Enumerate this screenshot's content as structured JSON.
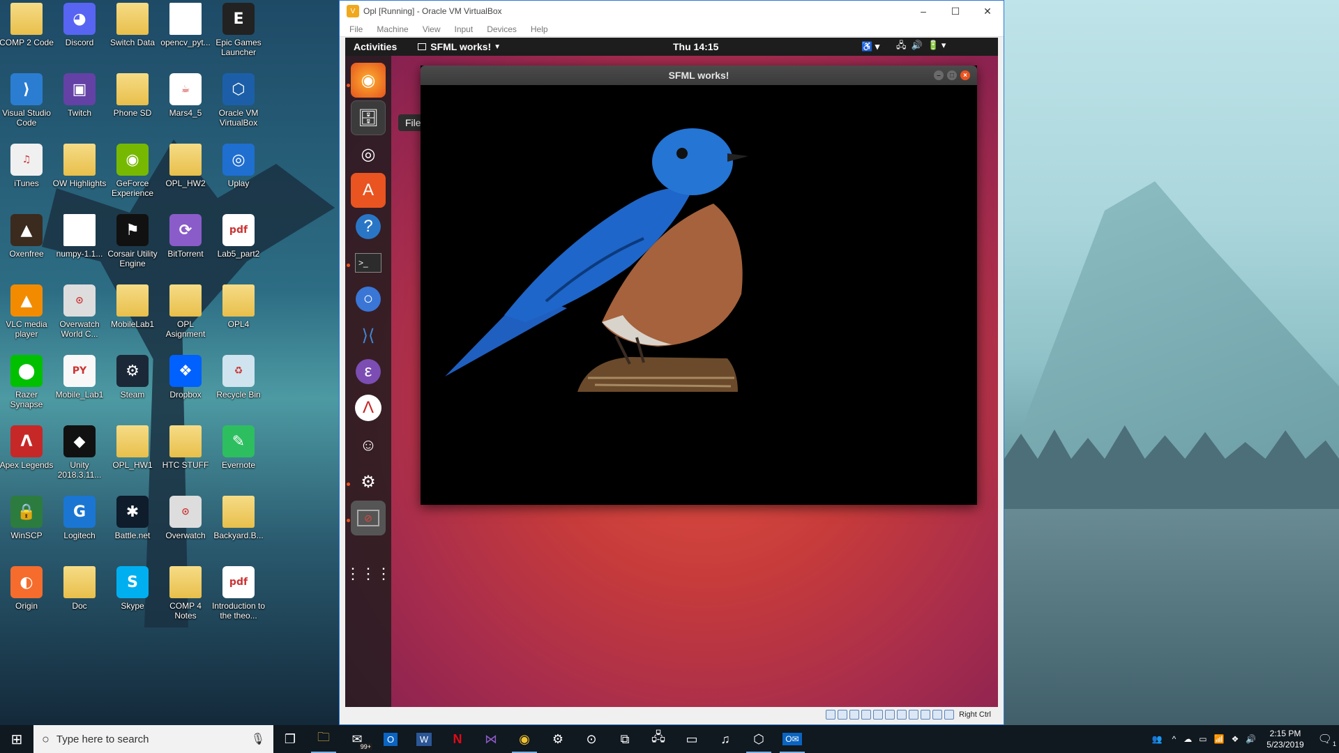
{
  "desktop": {
    "icons": [
      {
        "label": "COMP 2 Code",
        "glyph": "folder"
      },
      {
        "label": "Discord",
        "glyph": "discord-icon"
      },
      {
        "label": "Switch Data",
        "glyph": "folder"
      },
      {
        "label": "opencv_pyt...",
        "glyph": "file"
      },
      {
        "label": "Epic Games Launcher",
        "glyph": "epic-games-icon"
      },
      {
        "label": "Visual Studio Code",
        "glyph": "vscode-icon"
      },
      {
        "label": "Twitch",
        "glyph": "twitch-icon"
      },
      {
        "label": "Phone SD",
        "glyph": "folder"
      },
      {
        "label": "Mars4_5",
        "glyph": "java-icon"
      },
      {
        "label": "Oracle VM VirtualBox",
        "glyph": "virtualbox-icon"
      },
      {
        "label": "iTunes",
        "glyph": "itunes-icon"
      },
      {
        "label": "OW Highlights",
        "glyph": "folder"
      },
      {
        "label": "GeForce Experience",
        "glyph": "nvidia-icon"
      },
      {
        "label": "OPL_HW2",
        "glyph": "folder"
      },
      {
        "label": "Uplay",
        "glyph": "uplay-icon"
      },
      {
        "label": "Oxenfree",
        "glyph": "oxenfree-icon"
      },
      {
        "label": "numpy-1.1...",
        "glyph": "file"
      },
      {
        "label": "Corsair Utility Engine",
        "glyph": "corsair-icon"
      },
      {
        "label": "BitTorrent",
        "glyph": "bittorrent-icon"
      },
      {
        "label": "Lab5_part2",
        "glyph": "pdf-icon"
      },
      {
        "label": "VLC media player",
        "glyph": "vlc-icon"
      },
      {
        "label": "Overwatch World C...",
        "glyph": "overwatch-icon"
      },
      {
        "label": "MobileLab1",
        "glyph": "folder"
      },
      {
        "label": "OPL Asignment",
        "glyph": "folder"
      },
      {
        "label": "OPL4",
        "glyph": "folder"
      },
      {
        "label": "Razer Synapse",
        "glyph": "razer-icon"
      },
      {
        "label": "Mobile_Lab1",
        "glyph": "python-file-icon"
      },
      {
        "label": "Steam",
        "glyph": "steam-icon"
      },
      {
        "label": "Dropbox",
        "glyph": "dropbox-icon"
      },
      {
        "label": "Recycle Bin",
        "glyph": "recycle-bin-icon"
      },
      {
        "label": "Apex Legends",
        "glyph": "apex-icon"
      },
      {
        "label": "Unity 2018.3.11...",
        "glyph": "unity-icon"
      },
      {
        "label": "OPL_HW1",
        "glyph": "folder"
      },
      {
        "label": "HTC STUFF",
        "glyph": "folder"
      },
      {
        "label": "Evernote",
        "glyph": "evernote-icon"
      },
      {
        "label": "WinSCP",
        "glyph": "winscp-icon"
      },
      {
        "label": "Logitech",
        "glyph": "logitech-icon"
      },
      {
        "label": "Battle.net",
        "glyph": "battlenet-icon"
      },
      {
        "label": "Overwatch",
        "glyph": "overwatch-icon"
      },
      {
        "label": "Backyard.B...",
        "glyph": "folder"
      },
      {
        "label": "Origin",
        "glyph": "origin-icon"
      },
      {
        "label": "Doc",
        "glyph": "folder"
      },
      {
        "label": "Skype",
        "glyph": "skype-icon"
      },
      {
        "label": "COMP 4 Notes",
        "glyph": "folder"
      },
      {
        "label": "Introduction to the theo...",
        "glyph": "pdf-icon"
      }
    ]
  },
  "vbox": {
    "title": "Opl [Running] - Oracle VM VirtualBox",
    "menu": [
      "File",
      "Machine",
      "View",
      "Input",
      "Devices",
      "Help"
    ],
    "status_right": "Right Ctrl"
  },
  "guest": {
    "activities": "Activities",
    "app_menu": "SFML works!",
    "clock": "Thu 14:15",
    "tooltip": "Files",
    "window_title": "SFML works!"
  },
  "taskbar": {
    "search_placeholder": "Type here to search",
    "time": "2:15 PM",
    "date": "5/23/2019",
    "mail_badge": "99+",
    "notification_count": "1"
  }
}
